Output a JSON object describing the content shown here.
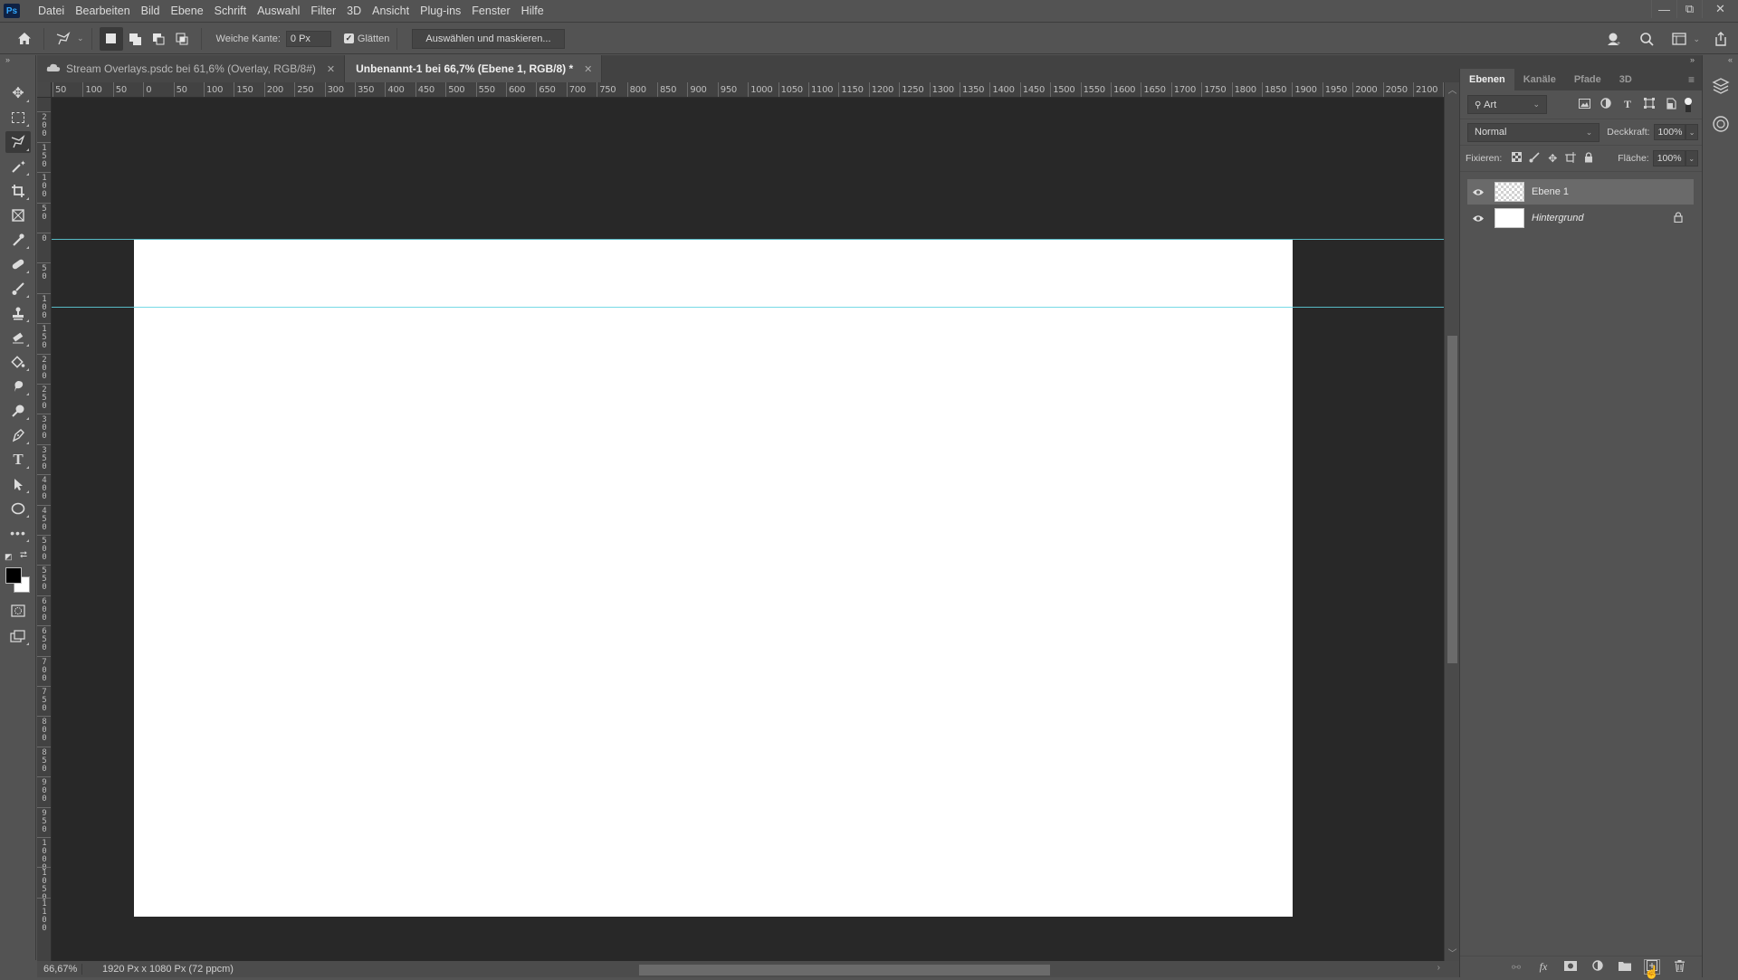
{
  "app": {
    "logo": "Ps"
  },
  "menu": [
    "Datei",
    "Bearbeiten",
    "Bild",
    "Ebene",
    "Schrift",
    "Auswahl",
    "Filter",
    "3D",
    "Ansicht",
    "Plug-ins",
    "Fenster",
    "Hilfe"
  ],
  "window_controls": {
    "minimize": "—",
    "restore": "⧉",
    "close": "✕"
  },
  "options_bar": {
    "feather_label": "Weiche Kante:",
    "feather_value": "0 Px",
    "antialias_label": "Glätten",
    "antialias_checked": true,
    "select_mask_button": "Auswählen und maskieren..."
  },
  "tabs": [
    {
      "label": "Stream Overlays.psdc bei 61,6% (Overlay, RGB/8#)",
      "active": false,
      "cloud": true
    },
    {
      "label": "Unbenannt-1 bei 66,7% (Ebene 1, RGB/8) *",
      "active": true,
      "cloud": false
    }
  ],
  "ruler_h": [
    "50",
    "100",
    "50",
    "0",
    "50",
    "100",
    "150",
    "200",
    "250",
    "300",
    "350",
    "400",
    "450",
    "500",
    "550",
    "600",
    "650",
    "700",
    "750",
    "800",
    "850",
    "900",
    "950",
    "1000",
    "1050",
    "1100",
    "1150",
    "1200",
    "1250",
    "1300",
    "1350",
    "1400",
    "1450",
    "1500",
    "1550",
    "1600",
    "1650",
    "1700",
    "1750",
    "1800",
    "1850",
    "1900",
    "1950",
    "2000",
    "2050",
    "2100",
    "21"
  ],
  "ruler_v": [
    "0",
    "200",
    "150",
    "100",
    "50",
    "0",
    "50",
    "100",
    "150",
    "200",
    "250",
    "300",
    "350",
    "400",
    "450",
    "500",
    "550",
    "600",
    "650",
    "700",
    "750",
    "800",
    "850",
    "900",
    "950",
    "1000",
    "1050",
    "1100"
  ],
  "status": {
    "zoom": "66,67%",
    "doc_size": "1920 Px x 1080 Px (72 ppcm)",
    "arrow": "❯"
  },
  "layers_panel": {
    "tabs": [
      "Ebenen",
      "Kanäle",
      "Pfade",
      "3D"
    ],
    "active_tab": "Ebenen",
    "filter_kind": "Art",
    "blend_mode": "Normal",
    "opacity_label": "Deckkraft:",
    "opacity_value": "100%",
    "lock_label": "Fixieren:",
    "fill_label": "Fläche:",
    "fill_value": "100%",
    "layers": [
      {
        "name": "Ebene 1",
        "visible": true,
        "selected": true,
        "locked": false,
        "thumb": "transparent"
      },
      {
        "name": "Hintergrund",
        "visible": true,
        "selected": false,
        "locked": true,
        "thumb": "white"
      }
    ]
  },
  "icons": {
    "eye": "👁",
    "lock": "🔒",
    "chevron_down": "⌄",
    "search": "🔍"
  }
}
